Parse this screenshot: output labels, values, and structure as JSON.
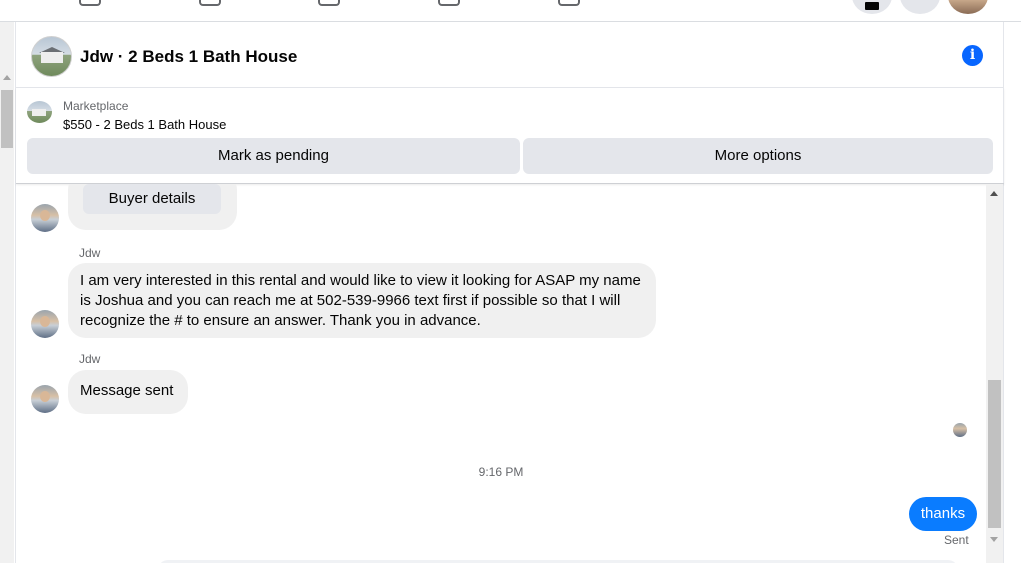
{
  "conversation": {
    "title": "Jdw · 2 Beds 1 Bath House"
  },
  "listing": {
    "source": "Marketplace",
    "title": "$550 - 2 Beds 1 Bath House",
    "mark_pending_label": "Mark as pending",
    "more_options_label": "More options"
  },
  "messages": {
    "buyer_details_label": "Buyer details",
    "items": [
      {
        "sender": "Jdw",
        "text": "I am very interested in this rental and would like to view it looking for ASAP my name is Joshua and you can reach me at 502-539-9966 text first if possible so that I will recognize the # to ensure an answer. Thank you in advance."
      },
      {
        "sender": "Jdw",
        "text": "Message sent"
      }
    ],
    "timestamp": "9:16 PM",
    "outgoing": {
      "text": "thanks",
      "status": "Sent"
    }
  },
  "colors": {
    "accent": "#0866ff",
    "outgoing_bubble": "#0a7cff",
    "incoming_bubble": "#f0f0f0",
    "button_bg": "#e4e6eb"
  },
  "icons": {
    "info": "info-icon",
    "nav": [
      "home-icon",
      "friends-icon",
      "video-icon",
      "marketplace-icon",
      "groups-icon",
      "menu-grid-icon",
      "notifications-icon"
    ]
  }
}
